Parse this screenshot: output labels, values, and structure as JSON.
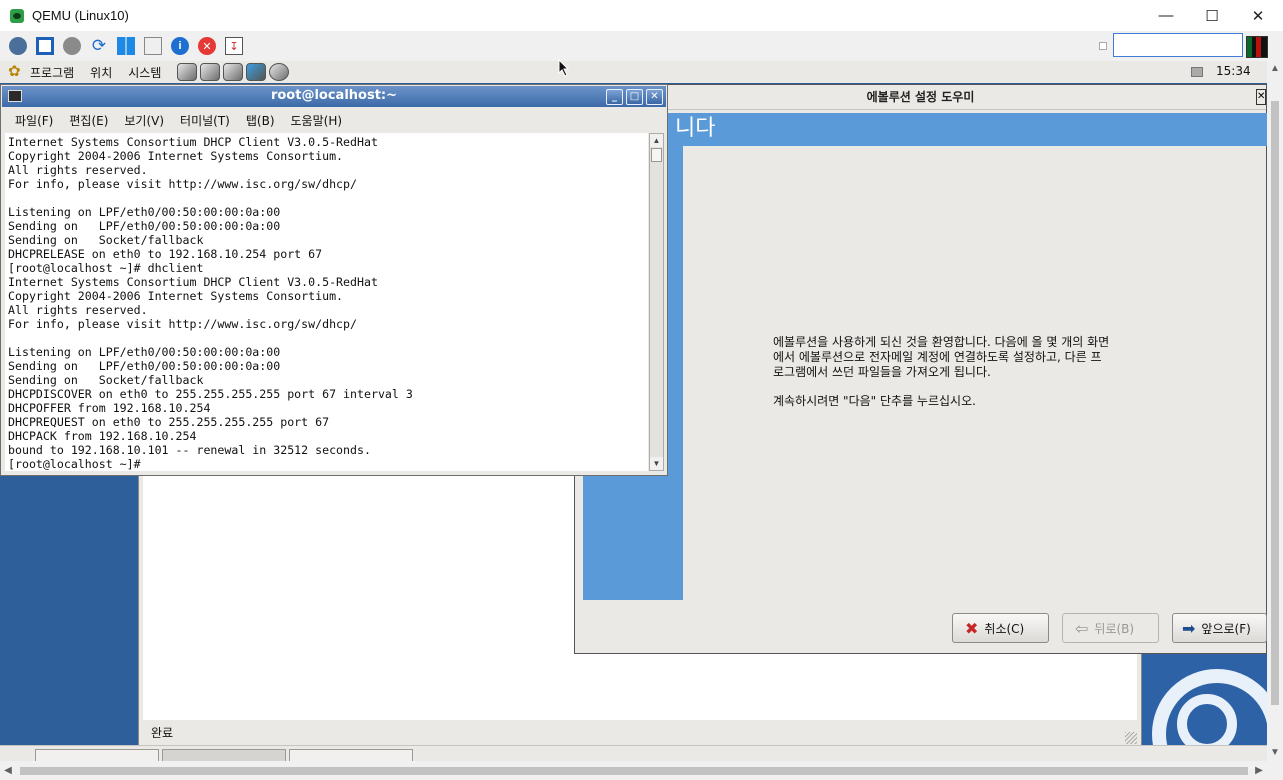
{
  "host": {
    "title": "QEMU (Linux10)",
    "controls": {
      "minimize": "—",
      "maximize": "☐",
      "close": "✕"
    },
    "toolbar_icons": [
      "settings-icon",
      "fullscreen-icon",
      "gear-icon",
      "refresh-icon",
      "windows-icon",
      "terminal-icon",
      "info-icon",
      "stop-icon",
      "reset-icon"
    ],
    "input_value": ""
  },
  "panel": {
    "menus": [
      "프로그램",
      "위치",
      "시스템"
    ],
    "launchers": [
      "browser-launcher-icon",
      "mail-launcher-icon",
      "note-launcher-icon",
      "draw-launcher-icon",
      "help-launcher-icon"
    ],
    "clock": "15:34"
  },
  "terminal": {
    "title": "root@localhost:~",
    "menu": [
      "파일(F)",
      "편집(E)",
      "보기(V)",
      "터미널(T)",
      "탭(B)",
      "도움말(H)"
    ],
    "lines": [
      "Internet Systems Consortium DHCP Client V3.0.5-RedHat",
      "Copyright 2004-2006 Internet Systems Consortium.",
      "All rights reserved.",
      "For info, please visit http://www.isc.org/sw/dhcp/",
      "",
      "Listening on LPF/eth0/00:50:00:00:0a:00",
      "Sending on   LPF/eth0/00:50:00:00:0a:00",
      "Sending on   Socket/fallback",
      "DHCPRELEASE on eth0 to 192.168.10.254 port 67",
      "[root@localhost ~]# dhclient",
      "Internet Systems Consortium DHCP Client V3.0.5-RedHat",
      "Copyright 2004-2006 Internet Systems Consortium.",
      "All rights reserved.",
      "For info, please visit http://www.isc.org/sw/dhcp/",
      "",
      "Listening on LPF/eth0/00:50:00:00:0a:00",
      "Sending on   LPF/eth0/00:50:00:00:0a:00",
      "Sending on   Socket/fallback",
      "DHCPDISCOVER on eth0 to 255.255.255.255 port 67 interval 3",
      "DHCPOFFER from 192.168.10.254",
      "DHCPREQUEST on eth0 to 255.255.255.255 port 67",
      "DHCPACK from 192.168.10.254",
      "bound to 192.168.10.101 -- renewal in 32512 seconds.",
      "[root@localhost ~]#"
    ]
  },
  "evolution": {
    "title": "에볼루션 설정 도우미",
    "header": "니다",
    "paragraph1": "에볼루션을 사용하게 되신 것을 환영합니다. 다음에 올 몇 개의 화면\n에서 에볼루션으로 전자메일 계정에 연결하도록 설정하고, 다른 프\n로그램에서 쓰던 파일들을 가져오게 됩니다.",
    "paragraph2": "계속하시려면 \"다음\" 단추를 누르십시오.",
    "buttons": {
      "cancel": "취소(C)",
      "back": "뒤로(B)",
      "forward": "앞으로(F)"
    }
  },
  "browser": {
    "status": "완료"
  },
  "colors": {
    "accent": "#5b9ad9",
    "terminal_title": "#3c6aa8",
    "desktop": "#2f5f9a",
    "panel": "#ebe9e5"
  }
}
